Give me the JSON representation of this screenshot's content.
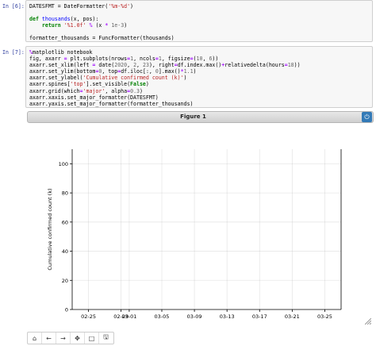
{
  "cells": [
    {
      "prompt": "In [6]:",
      "lines": [
        [
          [
            "DATESFMT = DateFormatter(",
            ""
          ],
          [
            "'%m-%d'",
            "str"
          ],
          [
            ")",
            ""
          ]
        ],
        [
          [
            "",
            ""
          ]
        ],
        [
          [
            "def",
            "kw"
          ],
          [
            " ",
            ""
          ],
          [
            "thousands",
            "fn"
          ],
          [
            "(x, pos):",
            ""
          ]
        ],
        [
          [
            "    ",
            ""
          ],
          [
            "return",
            "kw"
          ],
          [
            " ",
            ""
          ],
          [
            "'%1.0f'",
            "str"
          ],
          [
            " ",
            ""
          ],
          [
            "%",
            "op"
          ],
          [
            " (x ",
            ""
          ],
          [
            "*",
            "op"
          ],
          [
            " ",
            ""
          ],
          [
            "1e-3",
            "num"
          ],
          [
            ")",
            ""
          ]
        ],
        [
          [
            "",
            ""
          ]
        ],
        [
          [
            "formatter_thousands = FuncFormatter(thousands)",
            ""
          ]
        ]
      ]
    },
    {
      "prompt": "In [7]:",
      "lines": [
        [
          [
            "%",
            "op"
          ],
          [
            "matplotlib notebook",
            ""
          ]
        ],
        [
          [
            "fig, axarr ",
            ""
          ],
          [
            "=",
            "op"
          ],
          [
            " plt.subplots(nrows",
            ""
          ],
          [
            "=",
            "op"
          ],
          [
            "1",
            "num"
          ],
          [
            ", ncols",
            ""
          ],
          [
            "=",
            "op"
          ],
          [
            "1",
            "num"
          ],
          [
            ", figsize",
            ""
          ],
          [
            "=",
            "op"
          ],
          [
            "(",
            ""
          ],
          [
            "10",
            "num"
          ],
          [
            ", ",
            ""
          ],
          [
            "6",
            "num"
          ],
          [
            "))",
            ""
          ]
        ],
        [
          [
            "axarr.set_xlim(left ",
            ""
          ],
          [
            "=",
            "op"
          ],
          [
            " date(",
            ""
          ],
          [
            "2020",
            "num"
          ],
          [
            ", ",
            ""
          ],
          [
            "2",
            "num"
          ],
          [
            ", ",
            ""
          ],
          [
            "23",
            "num"
          ],
          [
            "), right",
            ""
          ],
          [
            "=",
            "op"
          ],
          [
            "df.index.max()",
            ""
          ],
          [
            "+",
            "op"
          ],
          [
            "relativedelta(hours",
            ""
          ],
          [
            "=",
            "op"
          ],
          [
            "18",
            "num"
          ],
          [
            "))",
            ""
          ]
        ],
        [
          [
            "axarr.set_ylim(bottom",
            ""
          ],
          [
            "=",
            "op"
          ],
          [
            "0",
            "num"
          ],
          [
            ", top",
            ""
          ],
          [
            "=",
            "op"
          ],
          [
            "df.iloc[:, ",
            ""
          ],
          [
            "0",
            "num"
          ],
          [
            "].max()",
            ""
          ],
          [
            "*",
            "op"
          ],
          [
            "1.1",
            "num"
          ],
          [
            ")",
            ""
          ]
        ],
        [
          [
            "axarr.set_ylabel(",
            ""
          ],
          [
            "'Cumulative confirmed count (k)'",
            "str"
          ],
          [
            ")",
            ""
          ]
        ],
        [
          [
            "axarr.spines[",
            ""
          ],
          [
            "'top'",
            "str"
          ],
          [
            "].set_visible(",
            ""
          ],
          [
            "False",
            "kw"
          ],
          [
            ")",
            ""
          ]
        ],
        [
          [
            "axarr.grid(which",
            ""
          ],
          [
            "=",
            "op"
          ],
          [
            "'major'",
            "str"
          ],
          [
            ", alpha",
            ""
          ],
          [
            "=",
            "op"
          ],
          [
            "0.3",
            "num"
          ],
          [
            ")",
            ""
          ]
        ],
        [
          [
            "axarr.xaxis.set_major_formatter(DATESFMT)",
            ""
          ]
        ],
        [
          [
            "axarr.yaxis.set_major_formatter(formatter_thousands)",
            ""
          ]
        ]
      ]
    }
  ],
  "figure": {
    "title": "Figure 1",
    "power_icon": "power-icon"
  },
  "chart_data": {
    "type": "line",
    "title": "",
    "xlabel": "",
    "ylabel": "Cumulative confirmed count (k)",
    "yticks": [
      "0",
      "20",
      "40",
      "60",
      "80",
      "100"
    ],
    "ylim": [
      0,
      110
    ],
    "xticks": [
      "02-25",
      "02-29",
      "03-01",
      "03-05",
      "03-09",
      "03-13",
      "03-17",
      "03-21",
      "03-25"
    ],
    "xlim": [
      "2020-02-23",
      "2020-03-27"
    ],
    "grid": true,
    "series": []
  },
  "toolbar": {
    "buttons": [
      {
        "icon": "home-icon",
        "glyph": "⌂"
      },
      {
        "icon": "back-arrow-icon",
        "glyph": "←"
      },
      {
        "icon": "forward-arrow-icon",
        "glyph": "→"
      },
      {
        "icon": "pan-move-icon",
        "glyph": "✥"
      },
      {
        "icon": "zoom-rect-icon",
        "glyph": "□"
      },
      {
        "icon": "save-download-icon",
        "glyph": "🖫"
      }
    ]
  }
}
